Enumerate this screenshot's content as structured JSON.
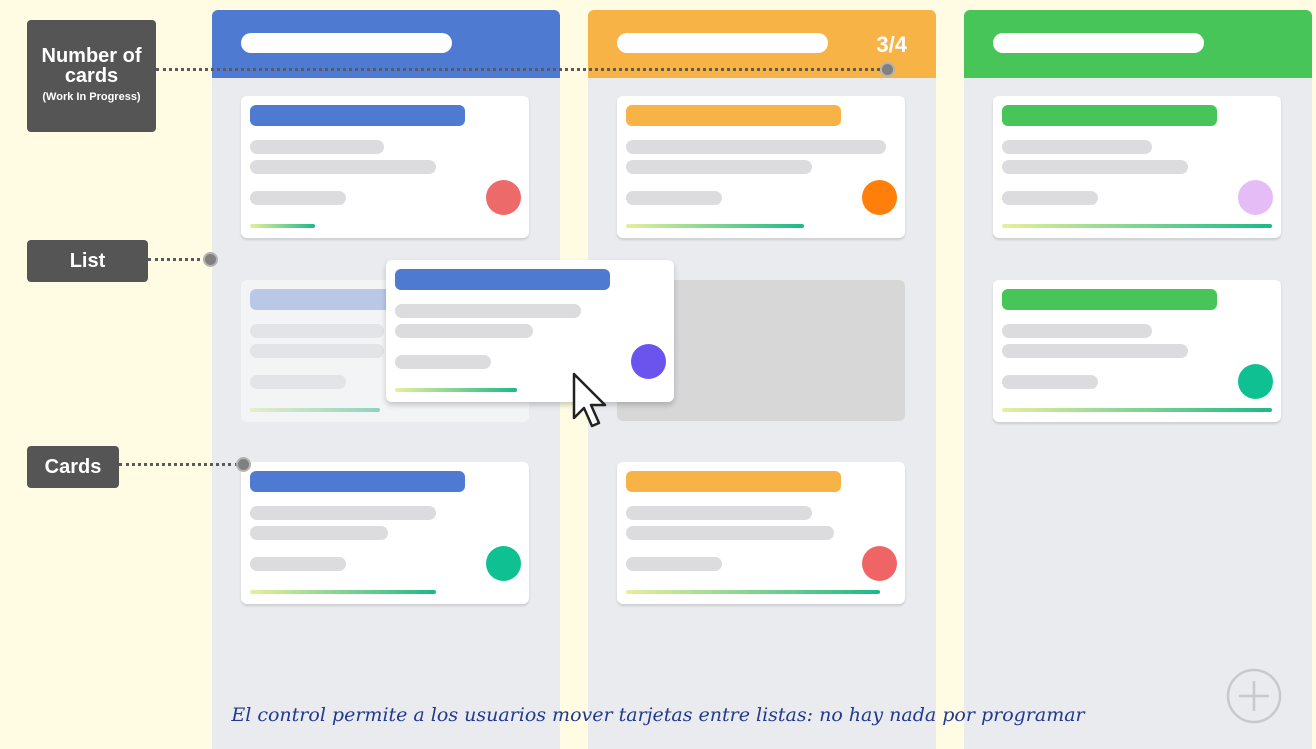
{
  "colors": {
    "background": "#fffce3",
    "column_bg": "#e9ebef",
    "blue": "#4f7ad1",
    "orange": "#f7b346",
    "green": "#47c558",
    "callout": "#555555",
    "caption": "#213a8f"
  },
  "callouts": {
    "wip_title": "Number of cards",
    "wip_subtitle": "(Work In Progress)",
    "list": "List",
    "cards": "Cards"
  },
  "columns": {
    "todo": {
      "header_color": "#4f7ad1"
    },
    "in_progress": {
      "header_color": "#f7b346",
      "wip_count": "3/4"
    },
    "done": {
      "header_color": "#47c558"
    }
  },
  "cards": {
    "todo_1": {
      "avatar_color": "#ec6a6a",
      "progress": 0.24
    },
    "todo_ghost": {
      "progress": 0.48
    },
    "todo_2": {
      "avatar_color": "#0fc192",
      "progress": 0.69
    },
    "dragged": {
      "avatar_color": "#6b54ee",
      "progress": 0.45
    },
    "progress_1": {
      "avatar_color": "#ff7f0a",
      "progress": 0.66
    },
    "progress_2": {
      "avatar_color": "#ef6565",
      "progress": 0.94
    },
    "done_1": {
      "avatar_color": "#e6bcf6",
      "progress": 1.0
    },
    "done_2": {
      "avatar_color": "#0fc192",
      "progress": 1.0
    }
  },
  "icons": {
    "cursor": "cursor-arrow-icon",
    "add": "plus-circle-icon"
  },
  "caption": "El control permite a los usuarios mover tarjetas entre listas: no hay nada por programar"
}
